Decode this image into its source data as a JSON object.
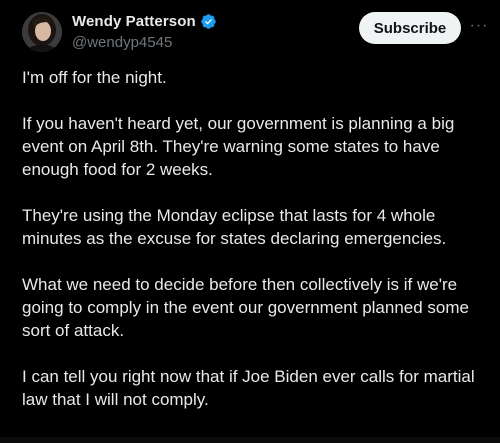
{
  "author": {
    "display_name": "Wendy Patterson",
    "handle": "@wendyp4545",
    "verified": true
  },
  "actions": {
    "subscribe_label": "Subscribe",
    "more_label": "···"
  },
  "post": {
    "paragraphs": [
      "I'm off for the night.",
      "If you haven't heard yet, our government is planning a big event on April 8th. They're warning some states to have enough food for 2 weeks.",
      "They're using the Monday eclipse that lasts for 4 whole minutes as the excuse for states declaring emergencies.",
      "What we need to decide before then collectively is if we're going to comply in the event our government planned some sort of attack.",
      "I can tell you right now that if Joe Biden ever calls for martial law that I will not comply."
    ]
  },
  "colors": {
    "background": "#000000",
    "text": "#e7e9ea",
    "muted": "#71767b",
    "verified_badge": "#1d9bf0",
    "subscribe_bg": "#eff3f4",
    "subscribe_text": "#0f1419"
  },
  "icons": {
    "verified": "verified-badge-icon",
    "more": "more-horizontal-icon"
  }
}
